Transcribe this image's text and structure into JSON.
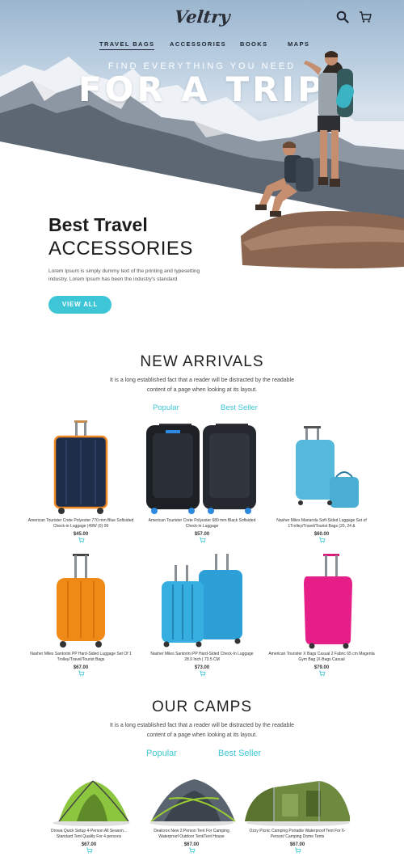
{
  "brand": {
    "logo": "Veltry"
  },
  "nav": {
    "items": [
      "TRAVEL BAGS",
      "ACCESSORIES",
      "BOOKS",
      "MAPS"
    ]
  },
  "hero": {
    "subtitle": "FIND EVERYTHING YOU NEED",
    "title": "FOR A TRIP"
  },
  "feature": {
    "title_line1": "Best Travel",
    "title_line2": "ACCESSORIES",
    "text": "Lorem Ipsum is simply dummy text of the printing and typesetting industry. Lorem Ipsum has been the industry's standard",
    "button": "VIEW ALL"
  },
  "arrivals": {
    "title": "NEW ARRIVALS",
    "description": "It is a long established fact that a reader will be distracted by the readable content of a page when looking at its layout.",
    "tabs": [
      "Popular",
      "Best Seller"
    ],
    "products": [
      {
        "name": "American Tourister Crete Polyester 770 mm Blue Softsided Check-in Luggage (49W (0) 09",
        "price": "$45.00"
      },
      {
        "name": "American Tourister Crete Polyester 680 mm Black Softsided Check-in Luggage",
        "price": "$57.00"
      },
      {
        "name": "Nasher Miles Manarola Soft-Sided Luggage Set of 1Trolley/Travel/Tourist Bags (20, 24 &",
        "price": "$60.00"
      },
      {
        "name": "Nasher Miles Santorini PP Hard-Sided Luggage Set Of 1 Trolley/Travel/Tourist Bags",
        "price": "$67.00"
      },
      {
        "name": "Nasher Miles Santorini PP Hard-Sided Check-In Luggage 28.9 Inch | 73.5 CM",
        "price": "$73.00"
      },
      {
        "name": "American Tourister X Bags Casual 2 Fabric 65 cm Magenta Gym Bag (X-Bags Casual",
        "price": "$79.00"
      }
    ]
  },
  "camps": {
    "title": "OUR CAMPS",
    "description": "It is a long established fact that a reader will be distracted by the readable content of a page when looking at its layout.",
    "tabs": [
      "Popular",
      "Best Seller"
    ],
    "products": [
      {
        "name": "Drowa Quick Setup 4-Person All Season... Standard Tent Quality For 4 persons",
        "price": "$67.00"
      },
      {
        "name": "Dealcrox New 2 Person Tent For Camping Waterproof Outdoor Tent/Tent House",
        "price": "$67.00"
      },
      {
        "name": "Ozzy Picnic Camping Portable Waterproof Tent For 6-Person/ Camping Dome Tents",
        "price": "$67.00"
      }
    ]
  },
  "colors": {
    "accent": "#3ec6d6",
    "dark": "#1e2530"
  }
}
